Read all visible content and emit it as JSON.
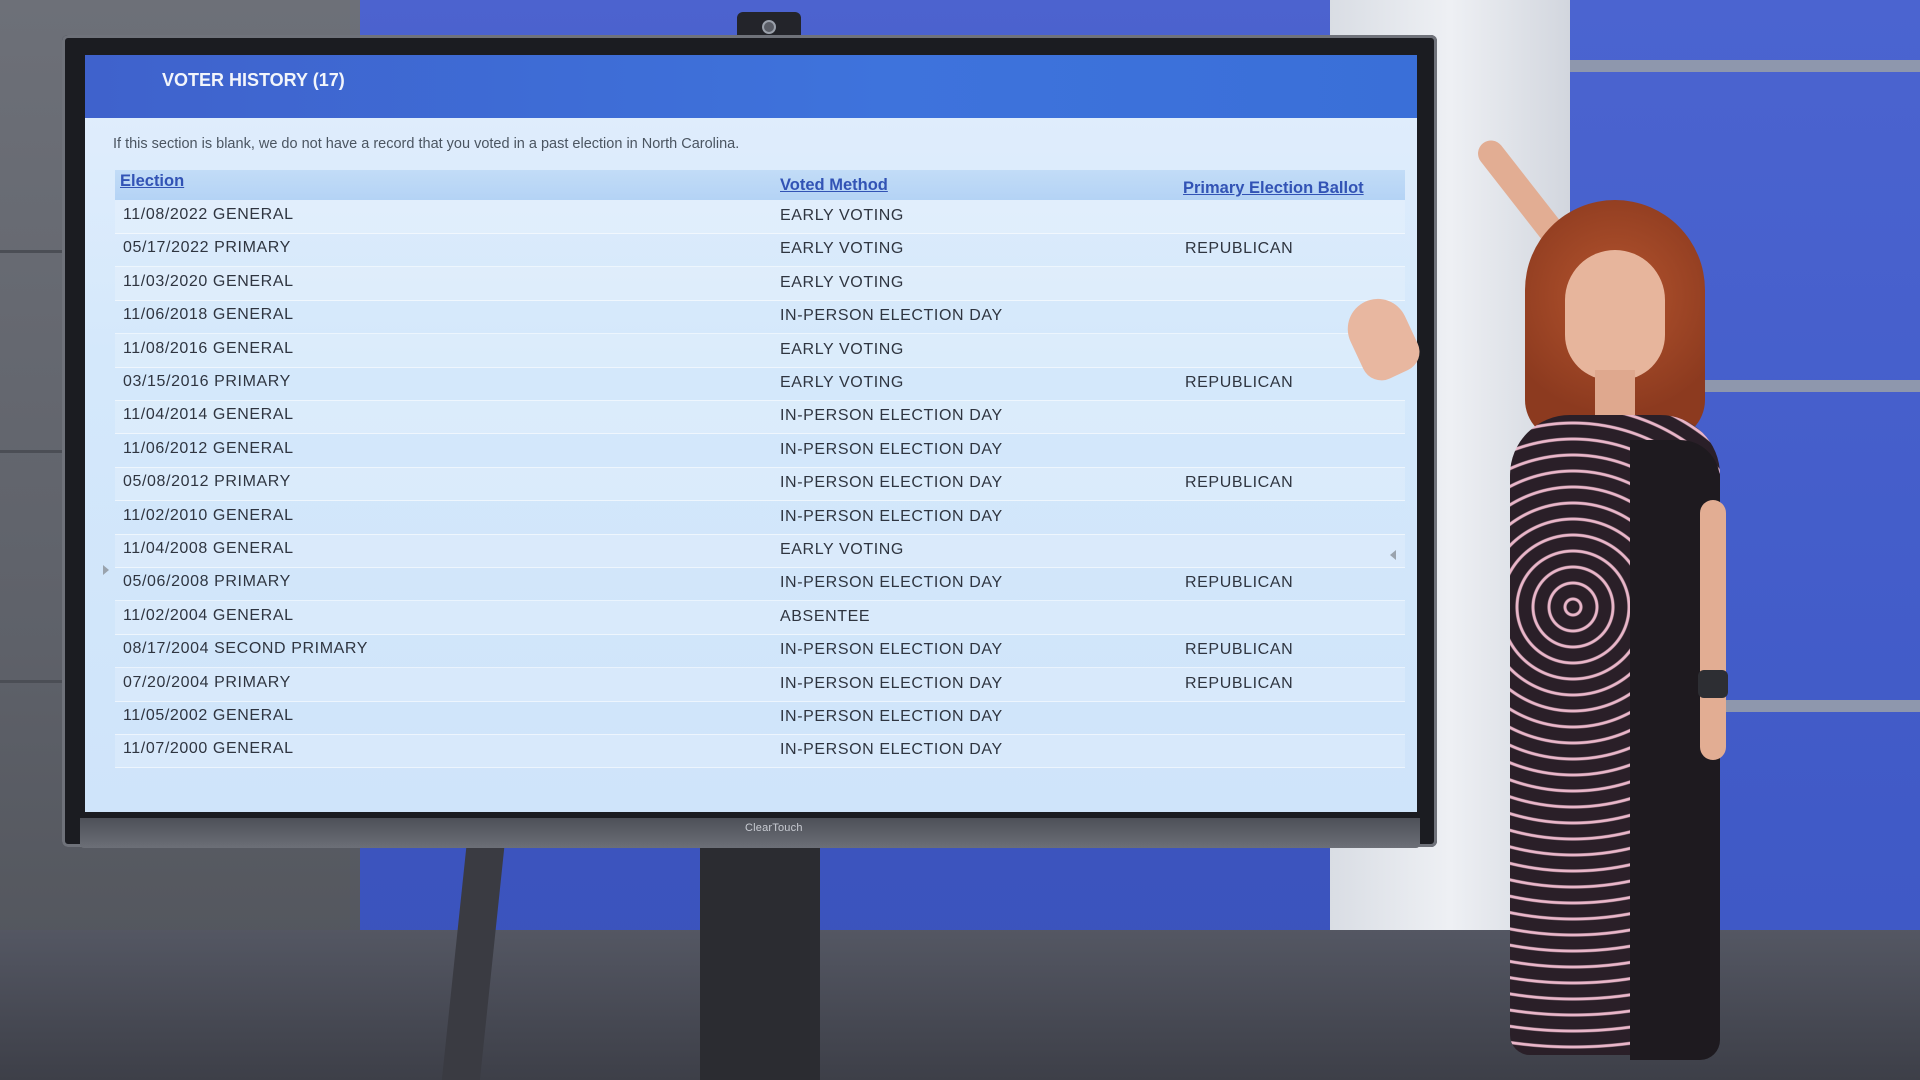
{
  "scene": {
    "display_brand": "ClearTouch"
  },
  "panel": {
    "title": "VOTER HISTORY (17)",
    "notice": "If this section is blank, we do not have a record that you voted in a past election in North Carolina."
  },
  "table": {
    "columns": {
      "election": "Election",
      "voted_method": "Voted Method",
      "primary_ballot": "Primary Election Ballot"
    },
    "rows": [
      {
        "election": "11/08/2022 GENERAL",
        "method": "EARLY VOTING",
        "ballot": ""
      },
      {
        "election": "05/17/2022 PRIMARY",
        "method": "EARLY VOTING",
        "ballot": "REPUBLICAN"
      },
      {
        "election": "11/03/2020 GENERAL",
        "method": "EARLY VOTING",
        "ballot": ""
      },
      {
        "election": "11/06/2018 GENERAL",
        "method": "IN-PERSON ELECTION DAY",
        "ballot": ""
      },
      {
        "election": "11/08/2016 GENERAL",
        "method": "EARLY VOTING",
        "ballot": ""
      },
      {
        "election": "03/15/2016 PRIMARY",
        "method": "EARLY VOTING",
        "ballot": "REPUBLICAN"
      },
      {
        "election": "11/04/2014 GENERAL",
        "method": "IN-PERSON ELECTION DAY",
        "ballot": ""
      },
      {
        "election": "11/06/2012 GENERAL",
        "method": "IN-PERSON ELECTION DAY",
        "ballot": ""
      },
      {
        "election": "05/08/2012 PRIMARY",
        "method": "IN-PERSON ELECTION DAY",
        "ballot": "REPUBLICAN"
      },
      {
        "election": "11/02/2010 GENERAL",
        "method": "IN-PERSON ELECTION DAY",
        "ballot": ""
      },
      {
        "election": "11/04/2008 GENERAL",
        "method": "EARLY VOTING",
        "ballot": ""
      },
      {
        "election": "05/06/2008 PRIMARY",
        "method": "IN-PERSON ELECTION DAY",
        "ballot": "REPUBLICAN"
      },
      {
        "election": "11/02/2004 GENERAL",
        "method": "ABSENTEE",
        "ballot": ""
      },
      {
        "election": "08/17/2004 SECOND PRIMARY",
        "method": "IN-PERSON ELECTION DAY",
        "ballot": "REPUBLICAN"
      },
      {
        "election": "07/20/2004 PRIMARY",
        "method": "IN-PERSON ELECTION DAY",
        "ballot": "REPUBLICAN"
      },
      {
        "election": "11/05/2002 GENERAL",
        "method": "IN-PERSON ELECTION DAY",
        "ballot": ""
      },
      {
        "election": "11/07/2000 GENERAL",
        "method": "IN-PERSON ELECTION DAY",
        "ballot": ""
      }
    ]
  },
  "colors": {
    "header_bar": "#3e6fd8",
    "link": "#3253b5",
    "row_text": "#2f3540",
    "screen_bg": "#d4e8fb"
  }
}
